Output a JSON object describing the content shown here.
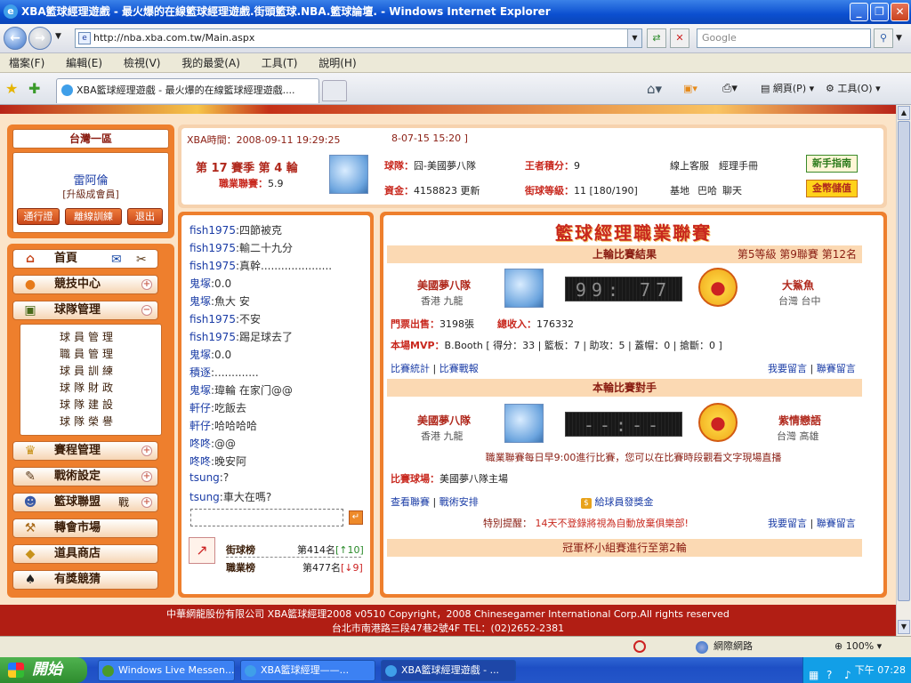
{
  "window": {
    "title": "XBA籃球經理遊戲 - 最火爆的在線籃球經理遊戲.街頭籃球.NBA.籃球論壇. - Windows Internet Explorer"
  },
  "browser": {
    "url": "http://nba.xba.com.tw/Main.aspx",
    "search_placeholder": "Google",
    "menu": [
      "檔案(F)",
      "編輯(E)",
      "檢視(V)",
      "我的最愛(A)",
      "工具(T)",
      "說明(H)"
    ],
    "tab_title": "XBA籃球經理遊戲 - 最火爆的在線籃球經理遊戲....",
    "tools": {
      "page": "網頁(P)",
      "tools": "工具(O)"
    }
  },
  "user": {
    "region": "台灣一區",
    "name": "雷阿倫",
    "level": "[升級成會員]",
    "buttons": [
      "通行證",
      "離線訓練",
      "退出"
    ]
  },
  "nav": {
    "home": "首頁",
    "items": [
      {
        "label": "競技中心",
        "icon": "basketball-icon"
      },
      {
        "label": "球隊管理",
        "icon": "team-icon",
        "expanded": true
      },
      {
        "label": "賽程管理",
        "icon": "trophy-icon"
      },
      {
        "label": "戰術設定",
        "icon": "tactics-icon"
      },
      {
        "label": "籃球聯盟",
        "icon": "league-icon",
        "suffix": "戰"
      },
      {
        "label": "轉會市場",
        "icon": "hammer-icon"
      },
      {
        "label": "道具商店",
        "icon": "shop-icon"
      },
      {
        "label": "有獎競猜",
        "icon": "spade-icon"
      }
    ],
    "team_sub": [
      "球員管理",
      "職員管理",
      "球員訓練",
      "球隊財政",
      "球隊建設",
      "球隊榮譽"
    ]
  },
  "status": {
    "xba_time_label": "XBA時間：",
    "xba_time": "2008-09-11 19:29:25",
    "other_time": "8-07-15 15:20 ]",
    "season": "第 17 賽季  第 4 輪",
    "league_label": "職業聯賽：",
    "league_value": "5.9",
    "team_label": "球隊：",
    "team_name": "囧-美國夢八隊",
    "funds_label": "資金：",
    "funds": "4158823",
    "refresh": "更新",
    "king_label": "王者積分：",
    "king_value": "9",
    "street_label": "街球等級：",
    "street_value": "11 [180/190]",
    "links1": [
      "線上客服",
      "經理手冊"
    ],
    "links2": [
      "基地",
      "巴哈",
      "聊天"
    ],
    "btn_newbie": "新手指南",
    "btn_gold": "金幣儲值"
  },
  "chat": [
    {
      "name": "fish1975",
      "msg": ":四節被克"
    },
    {
      "name": "fish1975",
      "msg": ":輸二十九分"
    },
    {
      "name": "fish1975",
      "msg": ":真幹....................."
    },
    {
      "name": "鬼塚",
      "msg": ":0.0"
    },
    {
      "name": "鬼塚",
      "msg": ":魚大 安"
    },
    {
      "name": "fish1975",
      "msg": ":不安"
    },
    {
      "name": "fish1975",
      "msg": ":踢足球去了"
    },
    {
      "name": "鬼塚",
      "msg": ":0.0"
    },
    {
      "name": "積逐",
      "msg": ":............."
    },
    {
      "name": "鬼塚",
      "msg": ":瑋輪 在家门@@"
    },
    {
      "name": "軒仔",
      "msg": ":吃飯去"
    },
    {
      "name": "軒仔",
      "msg": ":哈哈哈哈"
    },
    {
      "name": "咚咚",
      "msg": ":@@"
    },
    {
      "name": "咚咚",
      "msg": ":晚安阿"
    },
    {
      "name": "tsung",
      "msg": ":?"
    },
    {
      "name": "tsung",
      "msg": ":車大在嗎?"
    }
  ],
  "rank": {
    "street_label": "街球榜",
    "street_rank": "第414名",
    "street_delta": "[↑10]",
    "pro_label": "職業榜",
    "pro_rank": "第477名",
    "pro_delta": "[↓9]"
  },
  "league": {
    "title": "籃球經理職業聯賽",
    "last_header": "上輪比賽結果",
    "division": "第5等級  第9聯賽  第12名",
    "home_team": "美國夢八隊",
    "home_city": "香港 九龍",
    "last_score": "99: 77",
    "away_team": "大鯊魚",
    "away_city": "台灣 台中",
    "tickets_label": "門票出售：",
    "tickets": "3198張",
    "income_label": "總收入：",
    "income": "176332",
    "mvp_label": "本場MVP：",
    "mvp": "B.Booth",
    "mvp_stats": "[ 得分：33 | 籃板：7 | 助攻：5 | 蓋帽：0 | 搶斷：0 ]",
    "links_left1": [
      "比賽統計",
      "比賽戰報"
    ],
    "links_right": [
      "我要留言",
      "聯賽留言"
    ],
    "next_header": "本輪比賽對手",
    "next_home_team": "美國夢八隊",
    "next_home_city": "香港 九龍",
    "next_score": "--:--",
    "next_away_team": "紫情戀語",
    "next_away_city": "台灣 高雄",
    "notice": "職業聯賽每日早9:00進行比賽，您可以在比賽時段觀看文字現場直播",
    "venue_label": "比賽球場：",
    "venue": "美國夢八隊主場",
    "links_left2": [
      "查看聯賽",
      "戰術安排"
    ],
    "bonus": "給球員發獎金",
    "tip_label": "特別提醒：",
    "tip": "14天不登錄將視為自動放棄俱樂部!",
    "cup": "冠軍杯小組賽進行至第2輪"
  },
  "footer": {
    "line1": "中華網龍股份有限公司  XBA籃球經理2008 v0510     Copyright，2008 Chinesegamer International Corp.All rights reserved",
    "line2": "台北市南港路三段47巷2號4F TEL：(02)2652-2381"
  },
  "statusbar": {
    "zone": "網際網路",
    "zoom": "100%"
  },
  "taskbar": {
    "start": "開始",
    "tasks": [
      "Windows Live Messen...",
      "XBA籃球經理——...",
      "XBA籃球經理遊戲 - ..."
    ],
    "time": "下午 07:28"
  },
  "colors": {
    "accent": "#ee7f2d",
    "footer": "#b11e14",
    "title": "#0b4fd0"
  }
}
